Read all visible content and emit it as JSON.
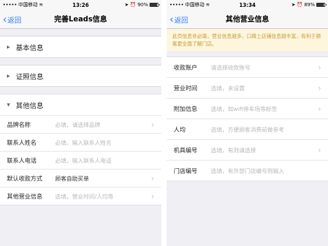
{
  "left": {
    "status": {
      "carrier": "中国移动",
      "time": "13:26",
      "battery_text": "90%",
      "battery_level": 0.9
    },
    "nav": {
      "back_label": "返回",
      "title": "完善Leads信息"
    },
    "sections": [
      {
        "label": "基本信息",
        "expanded": false,
        "arrow": "▶"
      },
      {
        "label": "证照信息",
        "expanded": false,
        "arrow": "▶"
      },
      {
        "label": "其他信息",
        "expanded": true,
        "arrow": "▼"
      }
    ],
    "rows": [
      {
        "label": "品牌名称",
        "value": "必填，请选择品牌",
        "filled": false,
        "arrow": true
      },
      {
        "label": "联系人姓名",
        "value": "必填，输入联系人姓名",
        "filled": false,
        "arrow": false
      },
      {
        "label": "联系人电话",
        "value": "必填，输入联系人电话",
        "filled": false,
        "arrow": false
      },
      {
        "label": "默认收款方式",
        "value": "顾客自助买单",
        "filled": true,
        "arrow": true
      },
      {
        "label": "其他营业信息",
        "value": "选填，营业时间/人均等",
        "filled": false,
        "arrow": true
      }
    ]
  },
  "right": {
    "status": {
      "carrier": "中国移动",
      "time": "13:34",
      "battery_text": "89%",
      "battery_level": 0.89
    },
    "nav": {
      "back_label": "返回",
      "title": "其他营业信息"
    },
    "notice": "此页信息非必填，营业信息越多，口碑上店铺信息越丰富，有利于顾客更全面了解门店。",
    "rows": [
      {
        "label": "收款账户",
        "value": "请选择收款账号",
        "arrow": true
      },
      {
        "label": "营业时间",
        "value": "选填，未设置",
        "arrow": true
      },
      {
        "label": "附加信息",
        "value": "选填，如wifi停车场等标签",
        "arrow": true
      },
      {
        "label": "人均",
        "value": "选填，方便顾客消费前做参考",
        "arrow": false
      },
      {
        "label": "机具编号",
        "value": "选填，有则请选择",
        "arrow": true
      },
      {
        "label": "门店编号",
        "value": "选填，有外部门店编号则输入",
        "arrow": false
      }
    ]
  },
  "icons": {
    "chevron_right": "›",
    "chevron_left": "‹"
  },
  "colors": {
    "accent": "#2f7bf6",
    "notice_bg": "#fdf6dc",
    "notice_text": "#c59a3a",
    "placeholder": "#b8b8b8"
  }
}
